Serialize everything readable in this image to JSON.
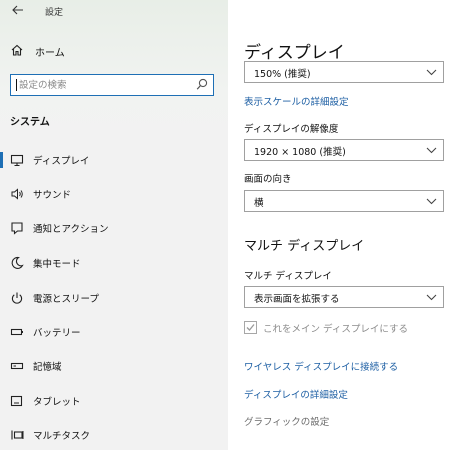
{
  "app": {
    "title": "設定"
  },
  "sidebar": {
    "home_label": "ホーム",
    "search_placeholder": "設定の検索",
    "section_label": "システム",
    "items": [
      {
        "label": "ディスプレイ",
        "icon": "monitor-icon",
        "active": true
      },
      {
        "label": "サウンド",
        "icon": "speaker-icon"
      },
      {
        "label": "通知とアクション",
        "icon": "notification-icon"
      },
      {
        "label": "集中モード",
        "icon": "moon-icon"
      },
      {
        "label": "電源とスリープ",
        "icon": "power-icon"
      },
      {
        "label": "バッテリー",
        "icon": "battery-icon"
      },
      {
        "label": "記憶域",
        "icon": "storage-icon"
      },
      {
        "label": "タブレット",
        "icon": "tablet-icon"
      },
      {
        "label": "マルチタスク",
        "icon": "multitask-icon"
      }
    ]
  },
  "main": {
    "title": "ディスプレイ",
    "scale_value": "150% (推奨)",
    "scale_link": "表示スケールの詳細設定",
    "resolution_label": "ディスプレイの解像度",
    "resolution_value": "1920 × 1080 (推奨)",
    "orientation_label": "画面の向き",
    "orientation_value": "横",
    "multi_title": "マルチ ディスプレイ",
    "multi_label": "マルチ ディスプレイ",
    "multi_value": "表示画面を拡張する",
    "main_display_checkbox": {
      "label": "これをメイン ディスプレイにする",
      "checked": true,
      "disabled": true
    },
    "wireless_link": "ワイヤレス ディスプレイに接続する",
    "advanced_link": "ディスプレイの詳細設定",
    "graphics_link": "グラフィックの設定"
  },
  "colors": {
    "accent": "#1e6fb5",
    "link": "#1c5ea3",
    "sidebar_bg": "#f2f2f2"
  }
}
